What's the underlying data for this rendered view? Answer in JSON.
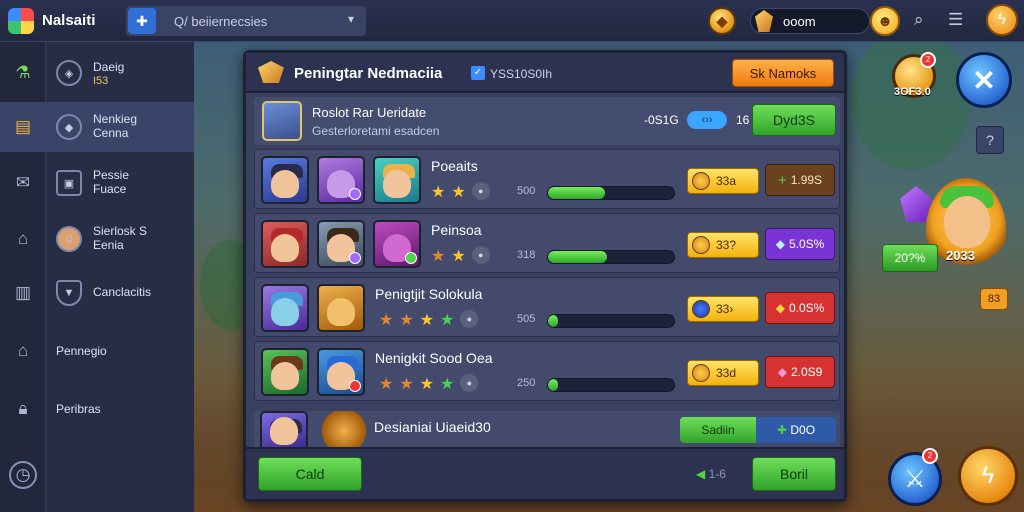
{
  "app": {
    "name": "Nalsaiti",
    "logo_icon": "colorful-app-logo"
  },
  "search": {
    "query": "Q/ beiiernecsies"
  },
  "topbar": {
    "currency_value": "ooom"
  },
  "sidebar": {
    "items": [
      {
        "icon": "potion-icon",
        "circle": "◈",
        "label": "Daeig",
        "sub": "I53"
      },
      {
        "icon": "treasure-chest-icon",
        "circle": "◆",
        "label": "Nenkieg",
        "sub": "Cenna",
        "active": true
      },
      {
        "icon": "mail-icon",
        "circle": "▣",
        "label": "Pessie",
        "sub": "Fuace"
      },
      {
        "icon": "castle-icon",
        "circle": "☺",
        "label": "Sierlosk S",
        "sub": "Eenia"
      },
      {
        "icon": "bus-icon",
        "circle": "▼",
        "label": "Canclacitis",
        "sub": ""
      },
      {
        "icon": "house-icon",
        "circle": "",
        "label": "Pennegio",
        "sub": ""
      },
      {
        "icon": "lock-icon",
        "circle": "",
        "label": "Peribras",
        "sub": ""
      },
      {
        "icon": "clock-icon",
        "circle": "",
        "label": "",
        "sub": ""
      }
    ]
  },
  "panel": {
    "title": "Peningtar Nedmaciia",
    "subtitle": "YSS10S0Ih",
    "orange_button": "Sk Namoks",
    "header": {
      "title": "Roslot Rar Ueridate",
      "subtitle": "Gesterloretami esadcen",
      "value": "-0S1G",
      "pill": "‹››",
      "num": "16",
      "button": "Dyd3S"
    },
    "rows": [
      {
        "title": "Poeaits",
        "stars": [
          "gold",
          "gold"
        ],
        "level": "500",
        "progress": 0.45,
        "pill": "33a",
        "right": "1.99S",
        "right_icon": "+",
        "right_style": "brown"
      },
      {
        "title": "Peinsoa",
        "stars": [
          "bronze",
          "gold"
        ],
        "level": "318",
        "progress": 0.47,
        "pill": "33?",
        "right": "5.0S%",
        "right_icon": "◆",
        "right_style": "purple"
      },
      {
        "title": "Penigtjit Solokula",
        "stars": [
          "bronze",
          "bronze",
          "gold",
          "green"
        ],
        "level": "505",
        "progress": 0.02,
        "pill": "33›",
        "right": "0.0S%",
        "right_icon": "◆",
        "right_style": "red"
      },
      {
        "title": "Nenigkit Sood Oea",
        "stars": [
          "bronze",
          "bronze",
          "gold",
          "green"
        ],
        "level": "250",
        "progress": 0.02,
        "pill": "33d",
        "right": "2.0S9",
        "right_icon": "◆",
        "right_style": "red"
      }
    ],
    "last_row": {
      "title": "Desianiai Uiaeid30",
      "pill_left": "Sadiin",
      "pill_right": "D0O"
    },
    "footer": {
      "left_button": "Cald",
      "mid_text": "1-6",
      "right_button": "Boril"
    }
  },
  "right_hud": {
    "reward_value": "3OF3.0",
    "reward_badge": "2",
    "small_box": "?",
    "hero_pct": "20?%",
    "hero_val": "2033",
    "hero_pin": "83",
    "bottom_badge": "2"
  }
}
